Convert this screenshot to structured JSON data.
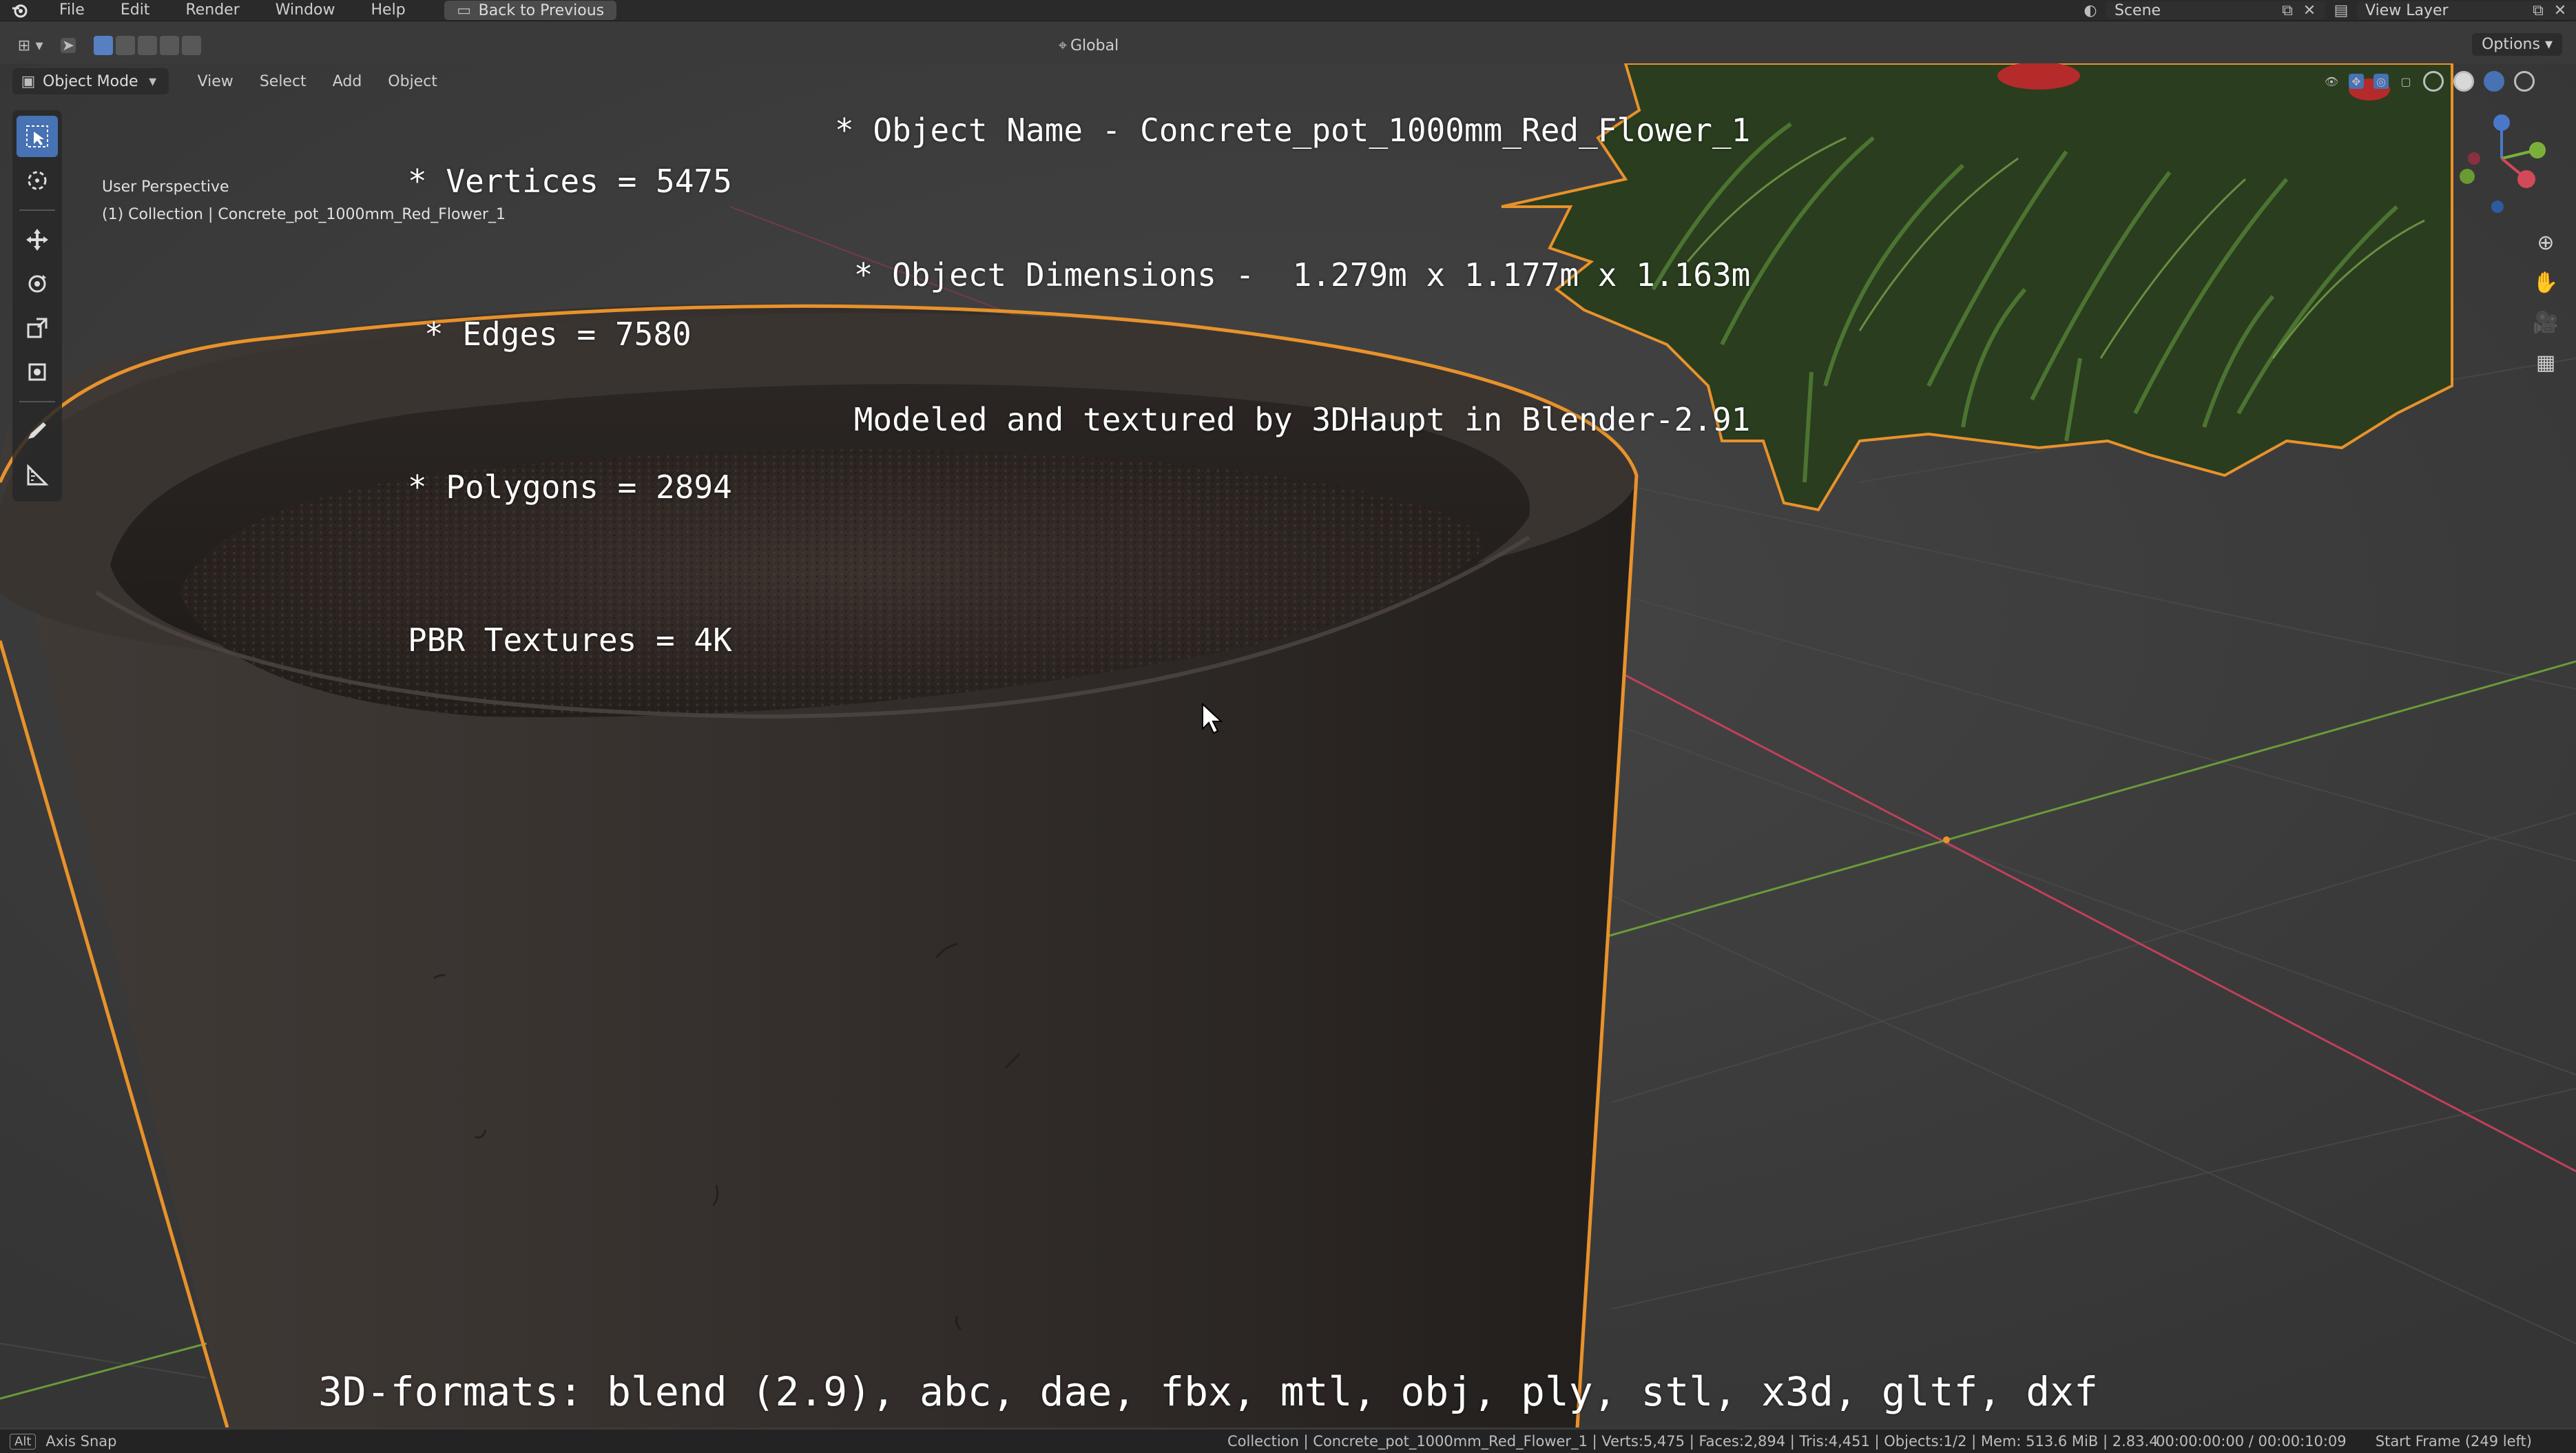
{
  "app": {
    "menu": [
      "File",
      "Edit",
      "Render",
      "Window",
      "Help"
    ],
    "back_button": "Back to Previous",
    "scene_label": "Scene",
    "view_layer_label": "View Layer",
    "options_label": "Options"
  },
  "header": {
    "mode": "Object Mode",
    "menus": [
      "View",
      "Select",
      "Add",
      "Object"
    ],
    "transform_orientation": "Global"
  },
  "viewport": {
    "perspective": "User Perspective",
    "collection_info": "(1) Collection | Concrete_pot_1000mm_Red_Flower_1"
  },
  "overlay_text": {
    "vertices": "* Vertices = 5475",
    "edges": "* Edges = 7580",
    "polygons": "* Polygons = 2894",
    "textures": "PBR Textures = 4K",
    "object_name": "* Object Name - Concrete_pot_1000mm_Red_Flower_1",
    "object_dimensions": " * Object Dimensions -  1.279m x 1.177m x 1.163m",
    "modeled_by": " Modeled and textured by 3DHaupt in Blender-2.91",
    "formats": "3D-formats: blend (2.9), abc, dae, fbx, mtl, obj, ply, stl, x3d, gltf, dxf"
  },
  "status": {
    "key": "Alt",
    "hint": "Axis Snap",
    "stats": "Collection | Concrete_pot_1000mm_Red_Flower_1 | Verts:5,475 | Faces:2,894 | Tris:4,451 | Objects:1/2 | Mem: 513.6 MiB | 2.83.4",
    "time": "00:00:00:00 / 00:00:10:09",
    "frame": "Start Frame (249 left)"
  },
  "colors": {
    "selection_outline": "#e8922b",
    "x_axis": "#c0405a",
    "y_axis": "#6b9a3a",
    "active_tool": "#4772b3"
  }
}
